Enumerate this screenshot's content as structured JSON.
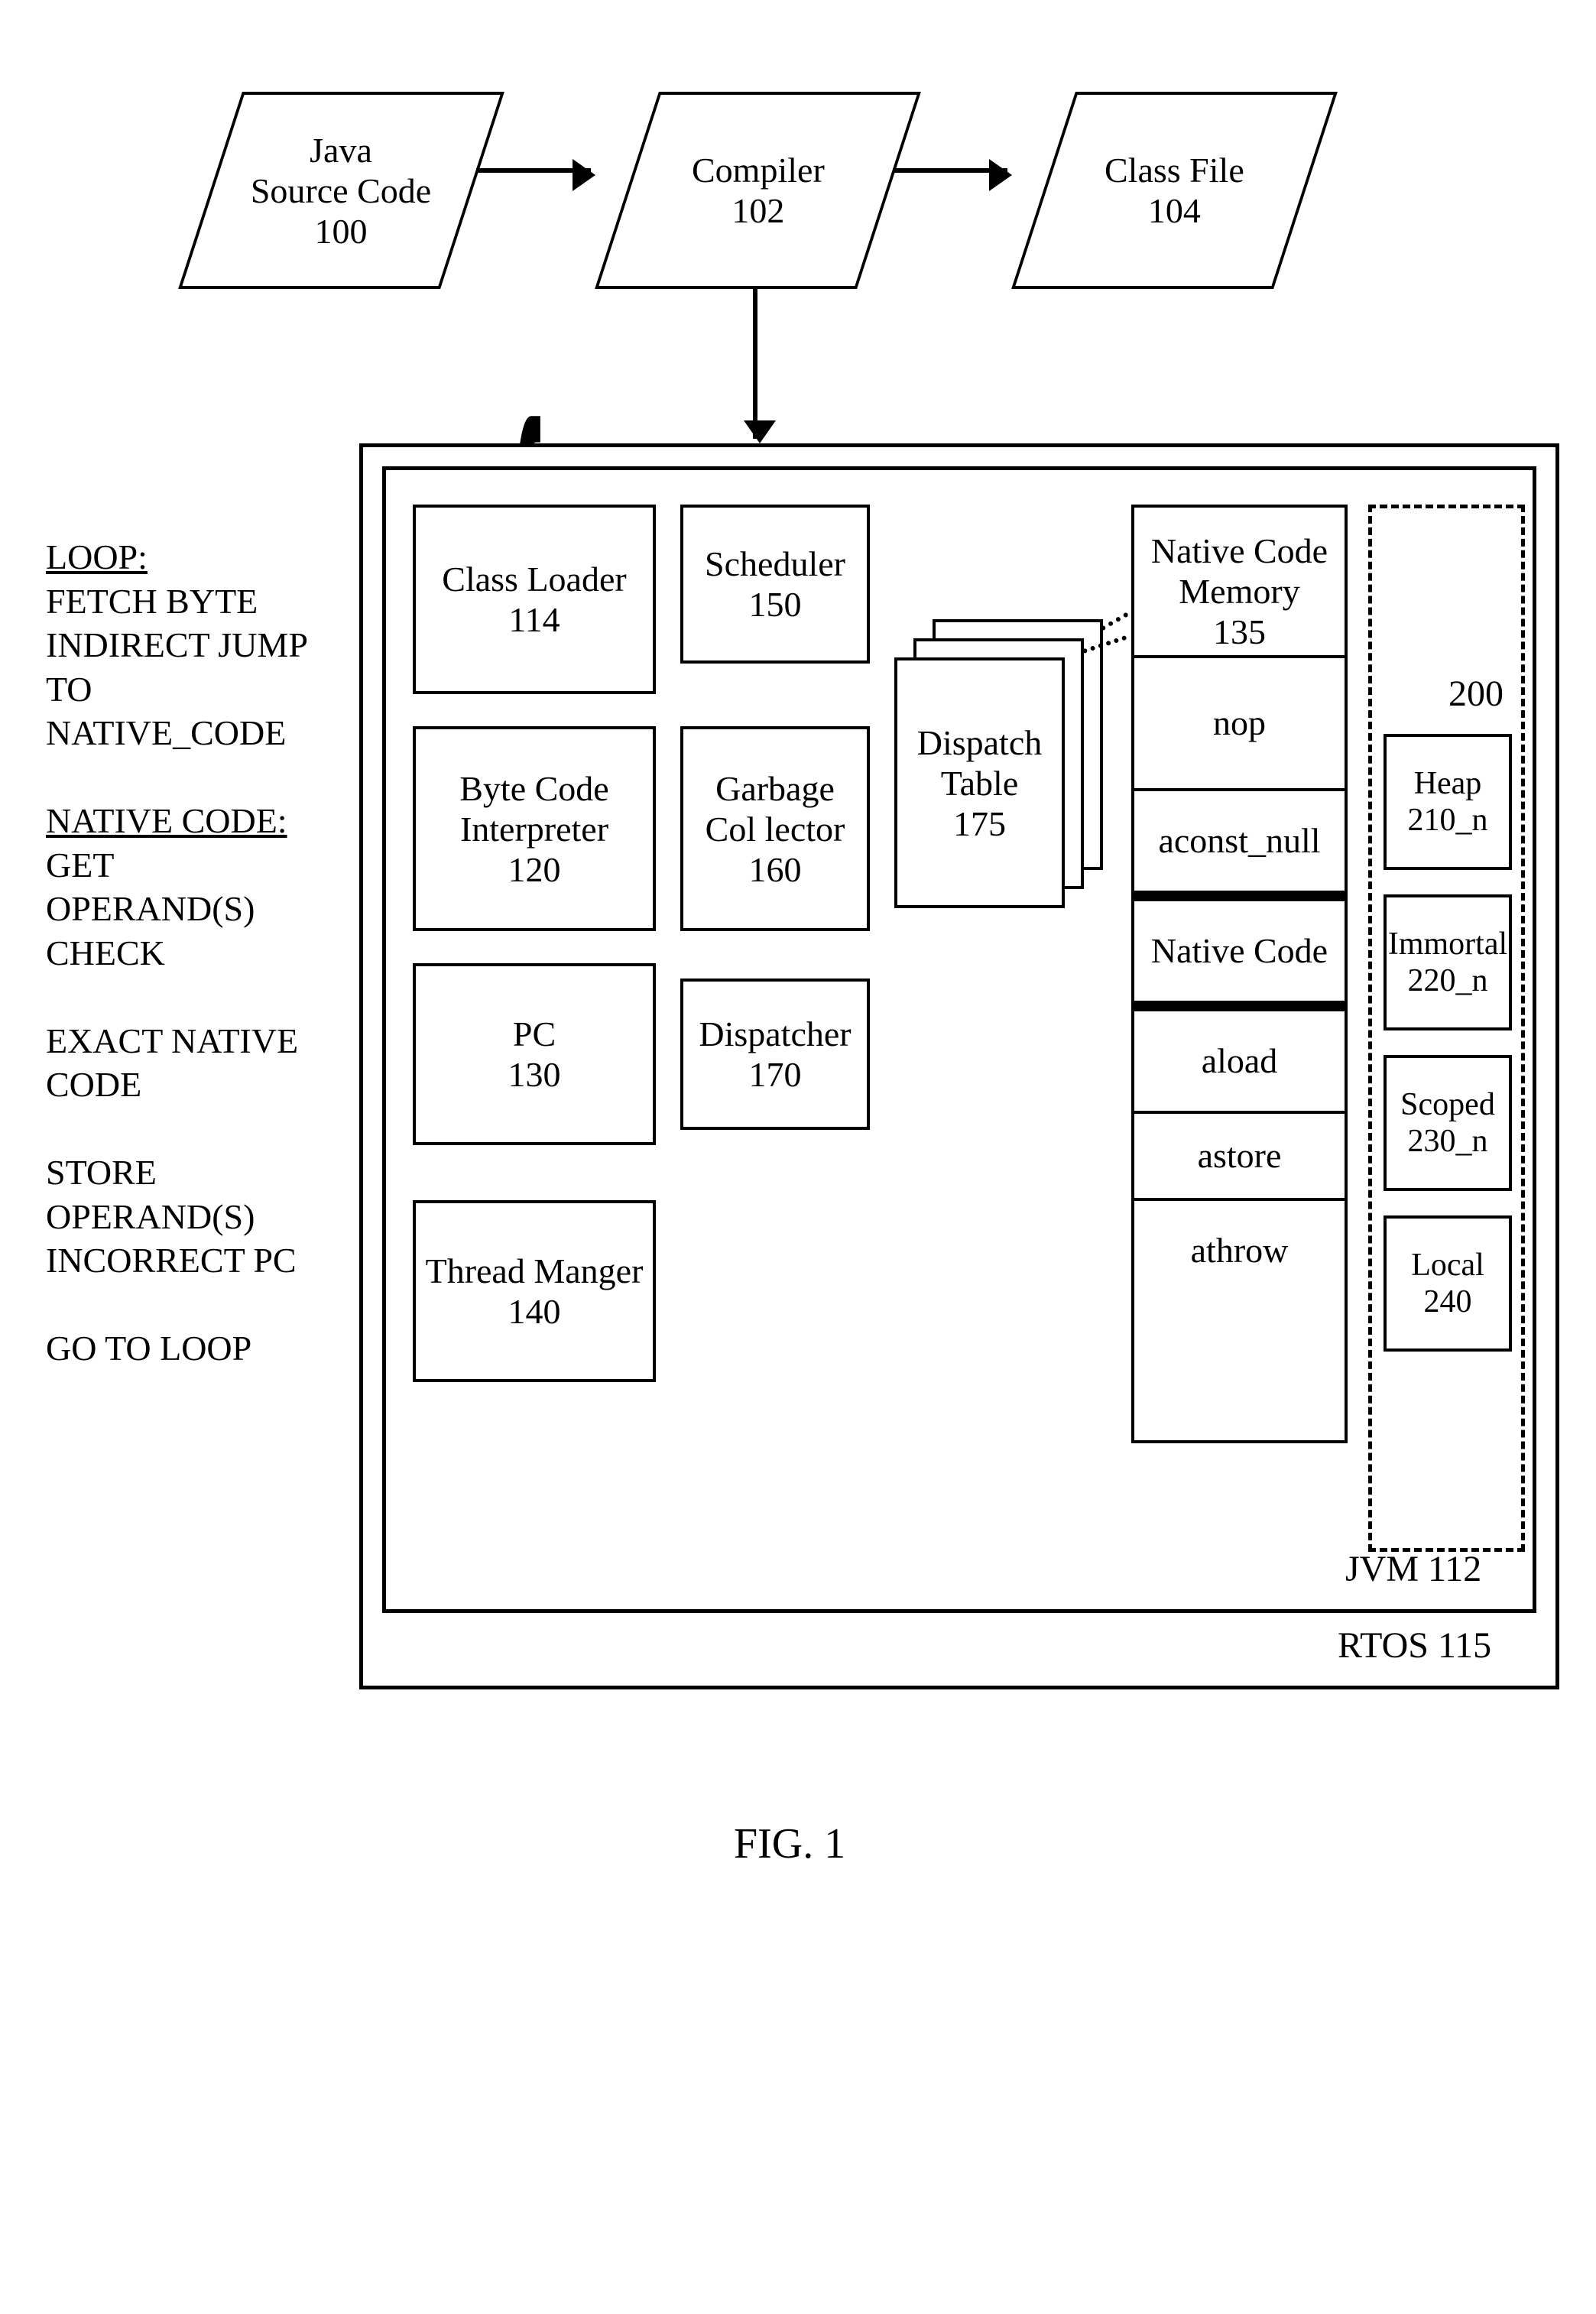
{
  "top": {
    "source": {
      "line1": "Java",
      "line2": "Source Code",
      "id": "100"
    },
    "compiler": {
      "line1": "Compiler",
      "id": "102"
    },
    "classfile": {
      "line1": "Class File",
      "id": "104"
    }
  },
  "loop": {
    "l1": "LOOP:",
    "l2": "FETCH BYTE",
    "l3": "INDIRECT JUMP",
    "l4": "TO",
    "l5": "NATIVE_CODE",
    "l6": "NATIVE CODE:",
    "l7": "GET",
    "l8": "OPERAND(S)",
    "l9": "CHECK",
    "l10": "EXACT NATIVE",
    "l11": "CODE",
    "l12": "STORE",
    "l13": "OPERAND(S)",
    "l14": "INCORRECT PC",
    "l15": "GO TO LOOP"
  },
  "rtos": {
    "label": "RTOS  115"
  },
  "jvm": {
    "label": "JVM  112"
  },
  "blocks": {
    "classLoader": {
      "l1": "Class Loader",
      "id": "114"
    },
    "scheduler": {
      "l1": "Scheduler",
      "id": "150"
    },
    "interpreter": {
      "l1": "Byte Code",
      "l2": "Interpreter",
      "id": "120"
    },
    "gc": {
      "l1": "Garbage",
      "l2": "Col lector",
      "id": "160"
    },
    "pc": {
      "l1": "PC",
      "id": "130"
    },
    "dispatcher": {
      "l1": "Dispatcher",
      "id": "170"
    },
    "threadmgr": {
      "l1": "Thread Manger",
      "id": "140"
    },
    "dispatchTable": {
      "l1": "Dispatch",
      "l2": "Table",
      "id": "175"
    }
  },
  "nativeCodeMem": {
    "title1": "Native Code Memory",
    "id": "135",
    "rows": [
      "nop",
      "aconst_null",
      "Native Code",
      "aload",
      "astore",
      "athrow"
    ]
  },
  "memArea": {
    "id": "200",
    "heap": {
      "l1": "Heap",
      "id": "210_n"
    },
    "immortal": {
      "l1": "Immortal",
      "id": "220_n"
    },
    "scoped": {
      "l1": "Scoped",
      "id": "230_n"
    },
    "local": {
      "l1": "Local",
      "id": "240"
    }
  },
  "figure": "FIG. 1"
}
